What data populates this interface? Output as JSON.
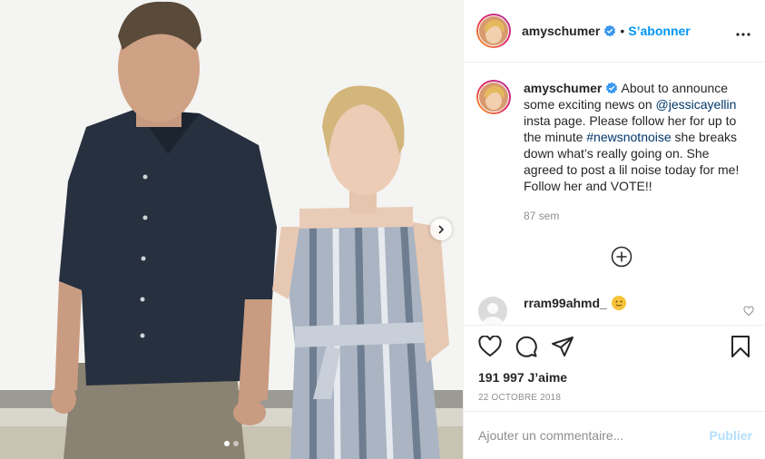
{
  "post": {
    "username": "amyschumer",
    "separator": "•",
    "follow_label": "S’abonner",
    "more_icon": "more-options-icon"
  },
  "caption": {
    "username": "amyschumer",
    "text_1": "About to announce some exciting news on ",
    "mention": "@jessicayellin",
    "text_2": " insta page. Please follow her for up to the minute ",
    "hashtag": "#newsnotnoise",
    "text_3": " she breaks down what’s really going on. She agreed to post a lil noise today for me! Follow her and VOTE!!",
    "age": "87 sem"
  },
  "comment": {
    "username": "rram99ahmd_",
    "emoji": "slightly-smiling-face"
  },
  "actions": {
    "likes": "191 997 J’aime",
    "date": "22 OCTOBRE 2018"
  },
  "add_comment": {
    "placeholder": "Ajouter un commentaire...",
    "post_label": "Publier"
  },
  "carousel": {
    "slide_count": 2,
    "active_index": 0
  },
  "colors": {
    "accent": "#0095f6",
    "link": "#00376b",
    "muted": "#8e8e8e",
    "post_disabled": "#b2dffc",
    "verified": "#3897f0"
  }
}
